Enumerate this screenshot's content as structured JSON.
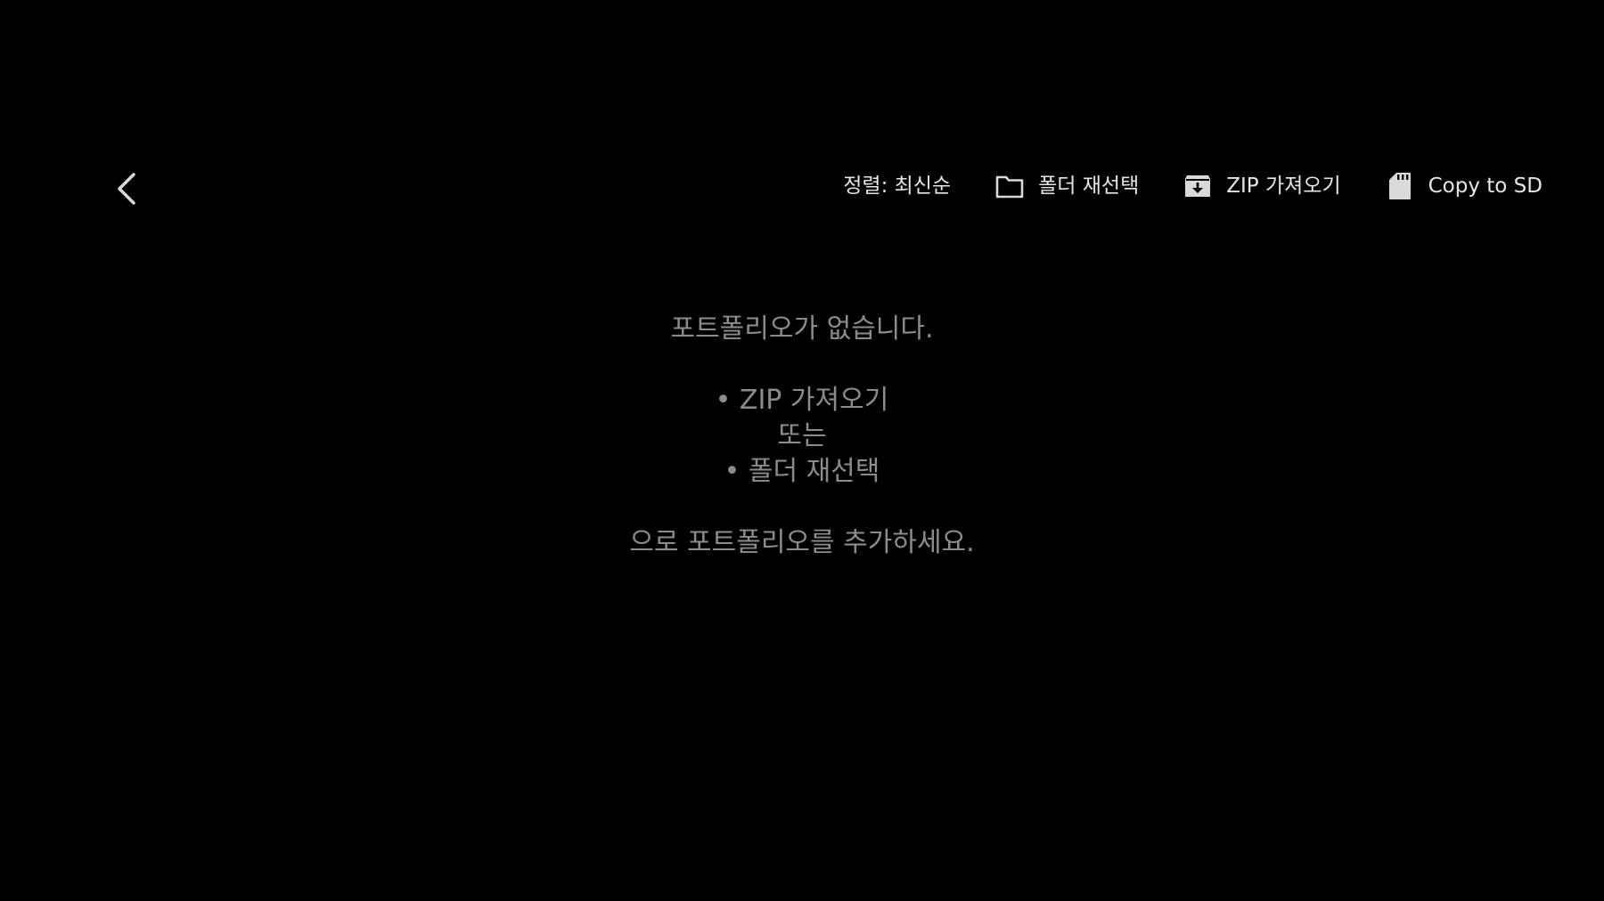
{
  "header": {
    "back_icon": "chevron-left-icon"
  },
  "toolbar": {
    "sort_label": "정렬: 최신순",
    "reselect_folder": {
      "icon": "folder-icon",
      "label": "폴더 재선택"
    },
    "import_zip": {
      "icon": "archive-download-icon",
      "label": "ZIP 가져오기"
    },
    "copy_to_sd": {
      "icon": "sd-card-icon",
      "label": "Copy to SD"
    }
  },
  "empty_state": {
    "line1": "포트폴리오가 없습니다.",
    "line2": "• ZIP 가져오기",
    "line3": "또는",
    "line4": "• 폴더 재선택",
    "line5": "으로 포트폴리오를 추가하세요."
  },
  "colors": {
    "background": "#000000",
    "toolbar_text": "#e6e6e6",
    "message_text": "#8c8c8c",
    "icon": "#d9d9d9"
  }
}
